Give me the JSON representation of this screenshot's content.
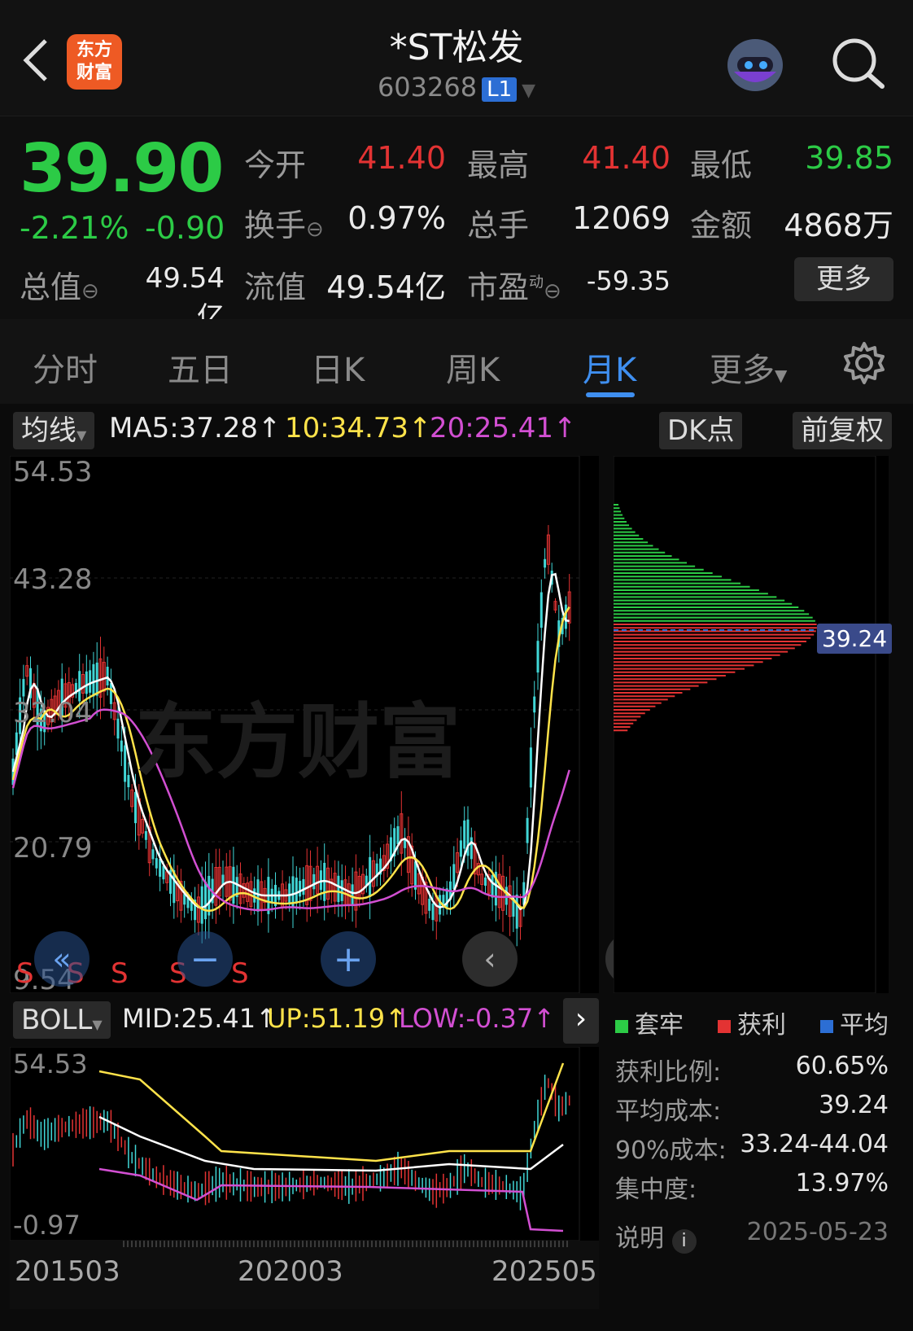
{
  "header": {
    "back_label": "<",
    "logo_text": "东方\n财富",
    "title": "*ST松发",
    "code": "603268",
    "level_badge": "L1"
  },
  "quote": {
    "price": "39.90",
    "pct": "-2.21%",
    "change": "-0.90",
    "open_label": "今开",
    "open": "41.40",
    "high_label": "最高",
    "high": "41.40",
    "low_label": "最低",
    "low": "39.85",
    "turnover_label": "换手",
    "turnover": "0.97%",
    "volume_label": "总手",
    "volume": "12069",
    "amount_label": "金额",
    "amount": "4868万",
    "mktcap_label": "总值",
    "mktcap": "49.54亿",
    "float_label": "流值",
    "float": "49.54亿",
    "pe_label": "市盈",
    "pe_sup": "动",
    "pe": "-59.35",
    "more_label": "更多"
  },
  "tabs": [
    {
      "label": "分时"
    },
    {
      "label": "五日"
    },
    {
      "label": "日K"
    },
    {
      "label": "周K"
    },
    {
      "label": "月K",
      "active": true
    },
    {
      "label": "更多"
    }
  ],
  "ma_bar": {
    "selector": "均线",
    "ma5": "MA5:37.28↑",
    "ma10": "10:34.73↑",
    "ma20": "20:25.41↑",
    "dk": "DK点",
    "adjust": "前复权"
  },
  "kline": {
    "y_labels": [
      "54.53",
      "43.28",
      "32.04",
      "20.79",
      "9.54"
    ],
    "s_marks": [
      "S",
      "S",
      "S",
      "S",
      "S"
    ],
    "watermark": "东方财富"
  },
  "boll": {
    "selector": "BOLL",
    "mid": "MID:25.41↑",
    "up": "UP:51.19↑",
    "low": "LOW:-0.37↑",
    "y_top": "54.53",
    "y_bottom": "-0.97"
  },
  "x_labels": [
    "201503",
    "202003",
    "202505"
  ],
  "chips": {
    "avg_label": "39.24",
    "legend": [
      {
        "label": "套牢",
        "color": "#2ccb46"
      },
      {
        "label": "获利",
        "color": "#e33333"
      },
      {
        "label": "平均",
        "color": "#2c6ed4"
      }
    ],
    "stats": [
      {
        "label": "获利比例:",
        "value": "60.65%"
      },
      {
        "label": "平均成本:",
        "value": "39.24"
      },
      {
        "label": "90%成本:",
        "value": "33.24-44.04"
      },
      {
        "label": "集中度:",
        "value": "13.97%"
      }
    ],
    "note_label": "说明",
    "date": "2025-05-23"
  },
  "colors": {
    "up": "#e33333",
    "down": "#2ccb46",
    "ma5": "#ffffff",
    "ma10": "#ffe34a",
    "ma20": "#d24fd2",
    "accent": "#3f8ff0"
  }
}
